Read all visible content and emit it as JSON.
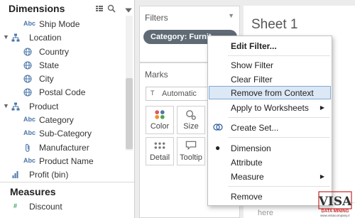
{
  "data_pane": {
    "title": "Dimensions",
    "fields": [
      {
        "type": "Abc",
        "label": "Ship Mode"
      },
      {
        "type": "hierarchy",
        "label": "Location"
      },
      {
        "type": "globe",
        "label": "Country"
      },
      {
        "type": "globe",
        "label": "State"
      },
      {
        "type": "globe",
        "label": "City"
      },
      {
        "type": "globe",
        "label": "Postal Code"
      },
      {
        "type": "hierarchy",
        "label": "Product"
      },
      {
        "type": "Abc",
        "label": "Category"
      },
      {
        "type": "Abc",
        "label": "Sub-Category"
      },
      {
        "type": "paperclip",
        "label": "Manufacturer"
      },
      {
        "type": "Abc",
        "label": "Product Name"
      },
      {
        "type": "bin",
        "label": "Profit (bin)"
      }
    ],
    "type_text": "Abc",
    "measures_title": "Measures",
    "measures": [
      {
        "type": "#",
        "label": "Discount"
      }
    ]
  },
  "filters": {
    "title": "Filters",
    "pill": "Category: Furnit"
  },
  "marks": {
    "title": "Marks",
    "type": "Automatic",
    "buttons": {
      "color": "Color",
      "size": "Size",
      "detail": "Detail",
      "tooltip": "Tooltip"
    }
  },
  "sheet": {
    "title": "Sheet 1",
    "drop": "here"
  },
  "context_menu": {
    "items": {
      "edit_filter": "Edit Filter...",
      "show_filter": "Show Filter",
      "clear_filter": "Clear Filter",
      "remove_context": "Remove from Context",
      "apply_worksheets": "Apply to Worksheets",
      "create_set": "Create Set...",
      "dimension": "Dimension",
      "attribute": "Attribute",
      "measure": "Measure",
      "remove": "Remove"
    }
  },
  "logo": {
    "letters": "VISA",
    "tagline": "DATA MINING",
    "url": "www.vistacompany.ir"
  },
  "colors": {
    "pill": "#5f6a75",
    "field_icon": "#4b76a8",
    "menu_highlight": "#dce8f5",
    "logo_red": "#c62828"
  }
}
